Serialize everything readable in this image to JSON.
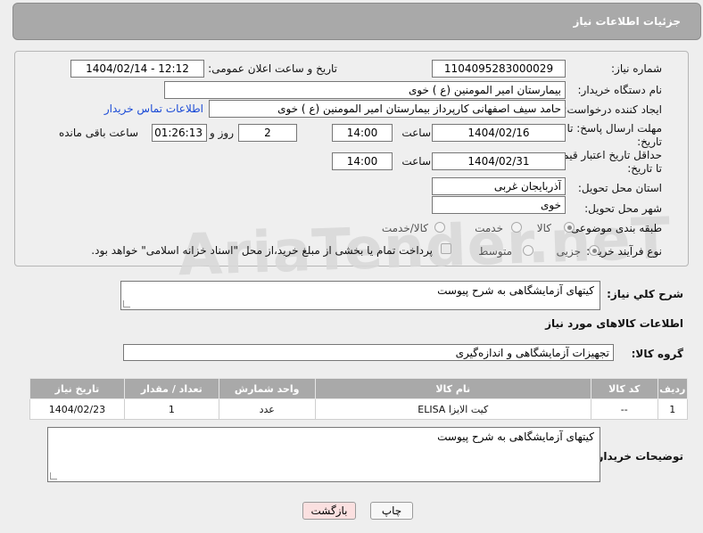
{
  "header": {
    "title": "جزئیات اطلاعات نیاز"
  },
  "fields": {
    "need_number_label": "شماره نیاز:",
    "need_number": "1104095283000029",
    "announce_label": "تاریخ و ساعت اعلان عمومی:",
    "announce_value": "1404/02/14 - 12:12",
    "buyer_org_label": "نام دستگاه خریدار:",
    "buyer_org": "بیمارستان امیر المومنین (ع ) خوی",
    "requester_label": "ایجاد کننده درخواست:",
    "requester": "حامد سیف اصفهانی کارپرداز بیمارستان امیر المومنین (ع ) خوی",
    "contact_link": "اطلاعات تماس خریدار",
    "deadline_label_1": "مهلت ارسال پاسخ: تا",
    "deadline_label_2": "تاریخ:",
    "deadline_date": "1404/02/16",
    "time_label": "ساعت",
    "deadline_time": "14:00",
    "days_value": "2",
    "days_label": "روز و",
    "remaining_time": "01:26:13",
    "remaining_label": "ساعت باقی مانده",
    "min_price_label_1": "حداقل تاریخ اعتبار قیمت:",
    "min_price_label_2": "تا تاریخ:",
    "min_price_date": "1404/02/31",
    "min_price_time": "14:00",
    "province_label": "استان محل تحویل:",
    "province": "آذربایجان غربی",
    "city_label": "شهر محل تحویل:",
    "city": "خوی",
    "category_label": "طبقه بندی موضوعی:",
    "category_options": [
      "کالا",
      "خدمت",
      "کالا/خدمت"
    ],
    "category_selected": "کالا",
    "process_label": "نوع فرآیند خرید :",
    "process_options": [
      "جزیی",
      "متوسط"
    ],
    "process_selected": "جزیی",
    "payment_note": "پرداخت تمام یا بخشی از مبلغ خرید،از محل \"اسناد خزانه اسلامی\" خواهد بود."
  },
  "description": {
    "label": "شرح کلي نياز:",
    "value": "کیتهای آزمایشگاهی به شرح پیوست"
  },
  "goods_section_title": "اطلاعات کالاهای مورد نیاز",
  "goods_group": {
    "label": "گروه کالا:",
    "value": "تجهیزات آزمایشگاهی و اندازه‌گیری"
  },
  "table": {
    "headers": [
      "ردیف",
      "کد کالا",
      "نام کالا",
      "واحد شمارش",
      "تعداد / مقدار",
      "تاریخ نیاز"
    ],
    "rows": [
      [
        "1",
        "--",
        "کیت الایزا ELISA",
        "عدد",
        "1",
        "1404/02/23"
      ]
    ]
  },
  "buyer_notes": {
    "label": "توضیحات خریدار:",
    "value": "کیتهای آزمایشگاهی به شرح پیوست"
  },
  "buttons": {
    "print": "چاپ",
    "back": "بازگشت"
  },
  "watermark": "AriaTender.neT"
}
